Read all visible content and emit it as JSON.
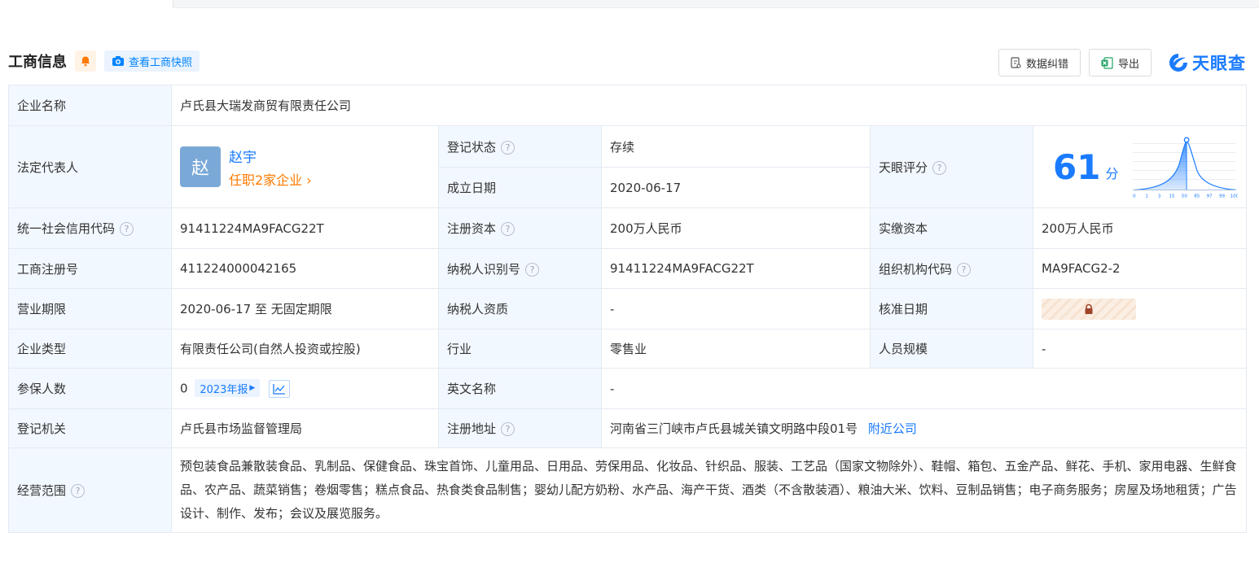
{
  "header": {
    "title": "工商信息",
    "snapshot_label": "查看工商快照",
    "correct_label": "数据纠错",
    "export_label": "导出",
    "logo_text": "天眼查"
  },
  "rows": {
    "company_name": {
      "label": "企业名称",
      "value": "卢氏县大瑞发商贸有限责任公司"
    },
    "legal_rep": {
      "label": "法定代表人",
      "avatar_char": "赵",
      "name": "赵宇",
      "positions": "任职2家企业"
    },
    "reg_status": {
      "label": "登记状态",
      "value": "存续"
    },
    "found_date": {
      "label": "成立日期",
      "value": "2020-06-17"
    },
    "score": {
      "label": "天眼评分",
      "value": "61",
      "unit": "分",
      "axis_ticks": [
        "0",
        "1",
        "3",
        "15",
        "50",
        "85",
        "97",
        "99",
        "100"
      ]
    },
    "credit_code": {
      "label": "统一社会信用代码",
      "value": "91411224MA9FACG22T"
    },
    "reg_capital": {
      "label": "注册资本",
      "value": "200万人民币"
    },
    "paid_capital": {
      "label": "实缴资本",
      "value": "200万人民币"
    },
    "reg_number": {
      "label": "工商注册号",
      "value": "411224000042165"
    },
    "taxpayer_id": {
      "label": "纳税人识别号",
      "value": "91411224MA9FACG22T"
    },
    "org_code": {
      "label": "组织机构代码",
      "value": "MA9FACG2-2"
    },
    "business_term": {
      "label": "营业期限",
      "value": "2020-06-17 至 无固定期限"
    },
    "taxpayer_qual": {
      "label": "纳税人资质",
      "value": "-"
    },
    "approval_date": {
      "label": "核准日期"
    },
    "company_type": {
      "label": "企业类型",
      "value": "有限责任公司(自然人投资或控股)"
    },
    "industry": {
      "label": "行业",
      "value": "零售业"
    },
    "staff_size": {
      "label": "人员规模",
      "value": "-"
    },
    "insured": {
      "label": "参保人数",
      "value": "0",
      "report": "2023年报"
    },
    "english_name": {
      "label": "英文名称",
      "value": "-"
    },
    "reg_authority": {
      "label": "登记机关",
      "value": "卢氏县市场监督管理局"
    },
    "reg_address": {
      "label": "注册地址",
      "value": "河南省三门峡市卢氏县城关镇文明路中段01号",
      "nearby": "附近公司"
    },
    "scope": {
      "label": "经营范围",
      "value": "预包装食品兼散装食品、乳制品、保健食品、珠宝首饰、儿童用品、日用品、劳保用品、化妆品、针织品、服装、工艺品（国家文物除外）、鞋帽、箱包、五金产品、鲜花、手机、家用电器、生鲜食品、农产品、蔬菜销售；卷烟零售；糕点食品、热食类食品制售；婴幼儿配方奶粉、水产品、海产干货、酒类（不含散装酒）、粮油大米、饮料、豆制品销售；电子商务服务；房屋及场地租赁；广告设计、制作、发布；会议及展览服务。"
    }
  },
  "colors": {
    "accent": "#1a7bff",
    "status_green": "#1b9e50",
    "orange": "#ff7a00",
    "label_bg": "#f2f8ff"
  }
}
